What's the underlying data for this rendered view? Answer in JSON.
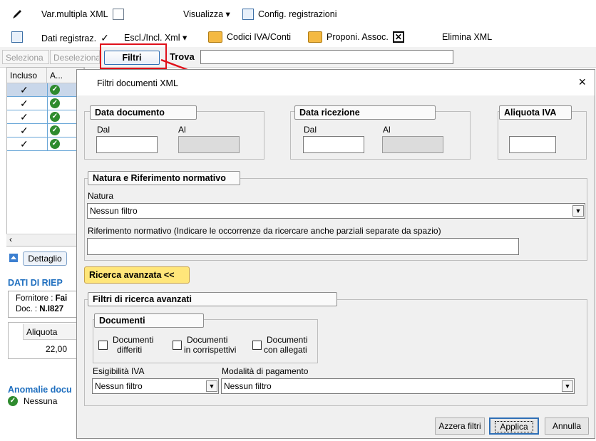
{
  "toolbar1": {
    "var_multipla": "Var.multipla XML",
    "visualizza": "Visualizza ▾",
    "config": "Config. registrazioni"
  },
  "toolbar2": {
    "dati_registraz": "Dati registraz.",
    "escl_incl": "Escl./Incl. Xml ▾",
    "codici": "Codici IVA/Conti",
    "proponi": "Proponi. Assoc.",
    "elimina": "Elimina XML"
  },
  "searchbar": {
    "seleziona": "Seleziona",
    "deseleziona": "Deseleziona",
    "filtri": "Filtri",
    "trova": "Trova",
    "trova_value": ""
  },
  "grid": {
    "headers": [
      "Incluso",
      "A..."
    ],
    "rows": 5
  },
  "left_panel": {
    "dettaglio": "Dettaglio",
    "dati_title": "DATI DI RIEP",
    "fornitore_label": "Fornitore : ",
    "fornitore_value": "Fai",
    "doc_label": "Doc. : ",
    "doc_value": "N.I827",
    "aliquota_header": "Aliquota",
    "aliquota_value": "22,00",
    "anomalie_title": "Anomalie docu",
    "anomalie_value": "Nessuna"
  },
  "dialog": {
    "title": "Filtri documenti XML",
    "close": "×",
    "data_documento": "Data documento",
    "data_ricezione": "Data ricezione",
    "aliquota_iva": "Aliquota IVA",
    "dal": "Dal",
    "al": "Al",
    "natura_group": "Natura e Riferimento normativo",
    "natura_label": "Natura",
    "natura_value": "Nessun filtro",
    "rif_label": "Riferimento normativo (Indicare le occorrenze da ricercare anche parziali separate da spazio)",
    "ricerca_avanzata": "Ricerca avanzata <<",
    "filtri_avanzati": "Filtri di ricerca avanzati",
    "documenti": "Documenti",
    "doc_differiti_1": "Documenti",
    "doc_differiti_2": "differiti",
    "doc_corrisp_1": "Documenti",
    "doc_corrisp_2": "in corrispettivi",
    "doc_allegati_1": "Documenti",
    "doc_allegati_2": "con allegati",
    "esigibilita_label": "Esigibilità IVA",
    "esigibilita_value": "Nessun filtro",
    "modalita_label": "Modalità di pagamento",
    "modalita_value": "Nessun filtro",
    "azzera": "Azzera filtri",
    "applica": "Applica",
    "annulla": "Annulla"
  },
  "colors": {
    "highlight": "#e0101a",
    "accent_blue": "#1f6fbf",
    "advanced_btn": "#ffe67a"
  }
}
